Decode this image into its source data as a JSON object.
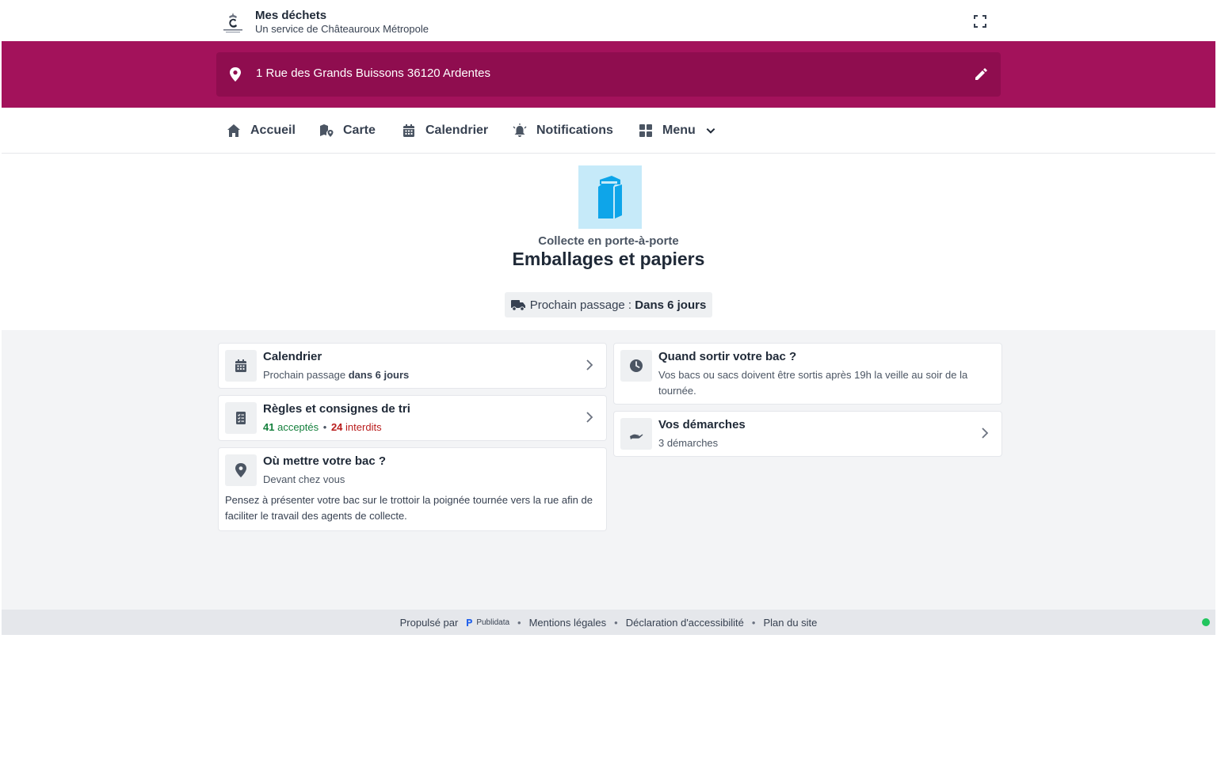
{
  "header": {
    "title": "Mes déchets",
    "subtitle": "Un service de Châteauroux Métropole"
  },
  "address": {
    "text": "1 Rue des Grands Buissons 36120 Ardentes"
  },
  "nav": {
    "items": [
      {
        "label": "Accueil",
        "icon": "home-icon"
      },
      {
        "label": "Carte",
        "icon": "map-icon"
      },
      {
        "label": "Calendrier",
        "icon": "calendar-icon"
      },
      {
        "label": "Notifications",
        "icon": "bell-icon"
      },
      {
        "label": "Menu",
        "icon": "grid-icon"
      }
    ]
  },
  "hero": {
    "subtitle": "Collecte en porte-à-porte",
    "title": "Emballages et papiers",
    "next_label": "Prochain passage :",
    "next_value": "Dans 6 jours",
    "icon_color": "#0ea5e9",
    "icon_bg": "#c6eaf9"
  },
  "cards": {
    "calendar": {
      "title": "Calendrier",
      "sub_prefix": "Prochain passage",
      "sub_bold": "dans 6 jours"
    },
    "rules": {
      "title": "Règles et consignes de tri",
      "accepted_count": "41",
      "accepted_label": "acceptés",
      "separator": "•",
      "forbidden_count": "24",
      "forbidden_label": "interdits"
    },
    "where": {
      "title": "Où mettre votre bac ?",
      "sub": "Devant chez vous",
      "body": "Pensez à présenter votre bac sur le trottoir la poignée tournée vers la rue afin de faciliter le travail des agents de collecte."
    },
    "when": {
      "title": "Quand sortir votre bac ?",
      "sub": "Vos bacs ou sacs doivent être sortis après 19h la veille au soir de la tournée."
    },
    "procedures": {
      "title": "Vos démarches",
      "sub": "3 démarches"
    }
  },
  "footer": {
    "powered_by": "Propulsé par",
    "publidata": "Publidata",
    "legal": "Mentions légales",
    "accessibility": "Déclaration d'accessibilité",
    "sitemap": "Plan du site",
    "separator": "•"
  },
  "colors": {
    "brand": "#a3125b",
    "brand_dark": "#8f0d4f",
    "accepted": "#15803d",
    "forbidden": "#b91c1c",
    "status": "#22c55e"
  }
}
